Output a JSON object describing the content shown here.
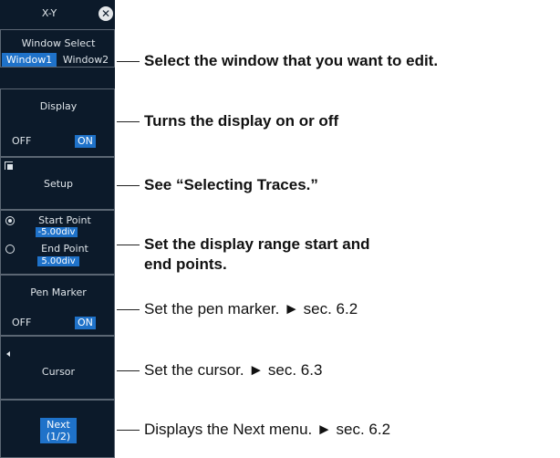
{
  "menu": {
    "title": "X-Y",
    "window_select": {
      "label": "Window Select",
      "options": [
        "Window1",
        "Window2"
      ],
      "selected": "Window1"
    },
    "display": {
      "label": "Display",
      "off": "OFF",
      "on": "ON",
      "value": "ON"
    },
    "setup": {
      "label": "Setup"
    },
    "start_point": {
      "label": "Start Point",
      "value": "-5.00div"
    },
    "end_point": {
      "label": "End Point",
      "value": "5.00div"
    },
    "pen_marker": {
      "label": "Pen Marker",
      "off": "OFF",
      "on": "ON",
      "value": "ON"
    },
    "cursor": {
      "label": "Cursor"
    },
    "next": {
      "line1": "Next",
      "line2": "(1/2)"
    }
  },
  "callouts": {
    "window": "Select the window that you want to edit.",
    "display": "Turns the display on or off",
    "setup": "See “Selecting Traces.”",
    "range_line1": "Set the display range start and",
    "range_line2": "end points.",
    "pen": "Set the pen marker. ► sec. 6.2",
    "cursor": "Set the cursor. ► sec. 6.3",
    "next": "Displays the Next menu. ► sec. 6.2"
  },
  "colors": {
    "panel_bg": "#0c1a2a",
    "selected_bg": "#1f72c9",
    "panel_text": "#dfe5ea"
  },
  "icons": [
    "close-icon",
    "setup-icon",
    "radio-selected-icon",
    "radio-icon",
    "left-arrow-icon"
  ]
}
